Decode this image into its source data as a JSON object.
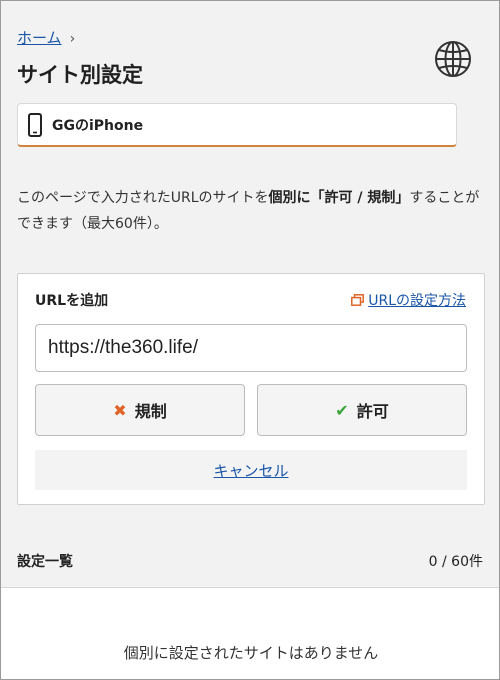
{
  "breadcrumb": {
    "home": "ホーム",
    "separator": "›"
  },
  "page": {
    "title": "サイト別設定"
  },
  "header_icon": "globe-icon",
  "device": {
    "name": "GGのiPhone",
    "icon": "smartphone-icon"
  },
  "description": {
    "prefix": "このページで入力されたURLのサイトを",
    "bold1": "個別に",
    "bold2": "「許可 / 規制」",
    "suffix": "することができます（最大60件）。"
  },
  "add_url": {
    "label": "URLを追加",
    "howto_link": "URLの設定方法",
    "howto_icon": "external-window-icon",
    "input_value": "https://the360.life/",
    "block_button": "規制",
    "block_icon": "x-icon",
    "allow_button": "許可",
    "allow_icon": "check-icon",
    "cancel": "キャンセル"
  },
  "list": {
    "title": "設定一覧",
    "count": "0 / 60件",
    "empty_message": "個別に設定されたサイトはありません"
  },
  "colors": {
    "link": "#1a56a8",
    "accent_orange": "#d0843a",
    "block_x": "#e06428",
    "allow_check": "#3aa53a"
  }
}
